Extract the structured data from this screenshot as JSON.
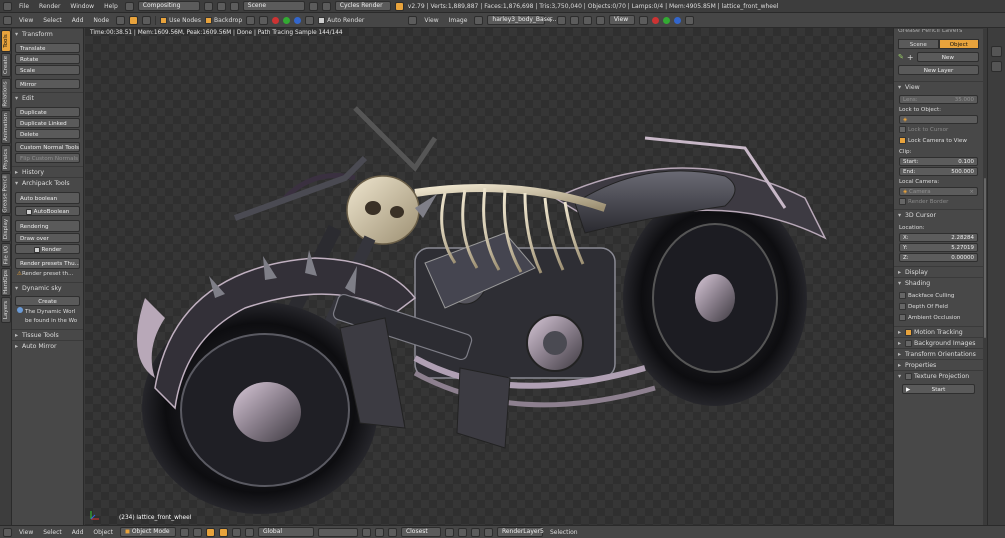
{
  "info_bar": {
    "menus": [
      "File",
      "Render",
      "Window",
      "Help"
    ],
    "screen_layout": "Compositing",
    "scene": "Scene",
    "engine": "Cycles Render",
    "stats": "v2.79 | Verts:1,889,887 | Faces:1,876,698 | Tris:3,750,040 | Objects:0/70 | Lamps:0/4 | Mem:4905.85M | lattice_front_wheel"
  },
  "node_header": {
    "menus": [
      "View",
      "Select",
      "Add",
      "Node"
    ],
    "use_nodes_label": "Use Nodes",
    "backdrop_label": "Backdrop",
    "auto_render_label": "Auto Render"
  },
  "image_header": {
    "menus": [
      "View",
      "Image"
    ],
    "image_name": "harley3_body_Base...",
    "image_flag": "F",
    "view_label": "View"
  },
  "left_tabs": [
    "Tools",
    "Create",
    "Relations",
    "Animation",
    "Physics",
    "Grease Pencil",
    "Display",
    "File I/O",
    "HardOps",
    "Layers"
  ],
  "tool_panels": {
    "transform": {
      "title": "Transform",
      "buttons": [
        "Translate",
        "Rotate",
        "Scale",
        "Mirror"
      ]
    },
    "edit": {
      "title": "Edit",
      "buttons": [
        "Duplicate",
        "Duplicate Linked",
        "Delete",
        "Custom Normal Tools",
        "Flip Custom Normals"
      ]
    },
    "history": {
      "title": "History"
    },
    "archipack": {
      "title": "Archipack Tools",
      "auto_boolean": "Auto boolean",
      "auto_boolean_btn": "AutoBoolean",
      "rendering": "Rendering",
      "draw_over": "Draw over",
      "render": "Render",
      "render_presets": "Render presets Thu...",
      "render_preset_warn": "Render preset th..."
    },
    "dynamic_sky": {
      "title": "Dynamic sky",
      "create": "Create",
      "info1": "The Dynamic Worl",
      "info2": "be found in the Wo"
    },
    "tissue": {
      "title": "Tissue Tools"
    },
    "auto_mirror": {
      "title": "Auto Mirror"
    }
  },
  "viewport": {
    "status": "Time:00:38.51 | Mem:1609.56M, Peak:1609.56M | Done | Path Tracing Sample 144/144",
    "object_label": "(234) lattice_front_wheel"
  },
  "properties": {
    "top_label": "Grease Pencil Layers",
    "scene_tab": "Scene",
    "object_tab": "Object",
    "new_btn": "New",
    "new_layer_btn": "New Layer",
    "view": {
      "title": "View",
      "lens_label": "Lens:",
      "lens_value": "35.000",
      "lock_to_object": "Lock to Object:",
      "lock_to_cursor": "Lock to Cursor",
      "lock_camera": "Lock Camera to View",
      "clip": "Clip:",
      "start_label": "Start:",
      "start_value": "0.100",
      "end_label": "End:",
      "end_value": "500.000",
      "local_camera": "Local Camera:",
      "camera_field": "Camera",
      "render_border": "Render Border"
    },
    "cursor": {
      "title": "3D Cursor",
      "location": "Location:",
      "x_label": "X:",
      "x_value": "2.28284",
      "y_label": "Y:",
      "y_value": "5.27019",
      "z_label": "Z:",
      "z_value": "0.00000"
    },
    "display_title": "Display",
    "shading": {
      "title": "Shading",
      "backface": "Backface Culling",
      "dof": "Depth Of Field",
      "ao": "Ambient Occlusion"
    },
    "motion_tracking": "Motion Tracking",
    "background_images": "Background Images",
    "transform_orientations": "Transform Orientations",
    "properties_title": "Properties",
    "texture_projection": "Texture Projection",
    "start_btn": "Start"
  },
  "bottom_bar": {
    "menus": [
      "View",
      "Select",
      "Add",
      "Object"
    ],
    "mode": "Object Mode",
    "orientation": "Global",
    "snap": "Closest",
    "render_layer": "RenderLayer5",
    "selection": "Selection"
  },
  "colors": {
    "accent": "#e8a33c",
    "panel": "#484848",
    "viewport_dark": "#2f2f2f"
  }
}
